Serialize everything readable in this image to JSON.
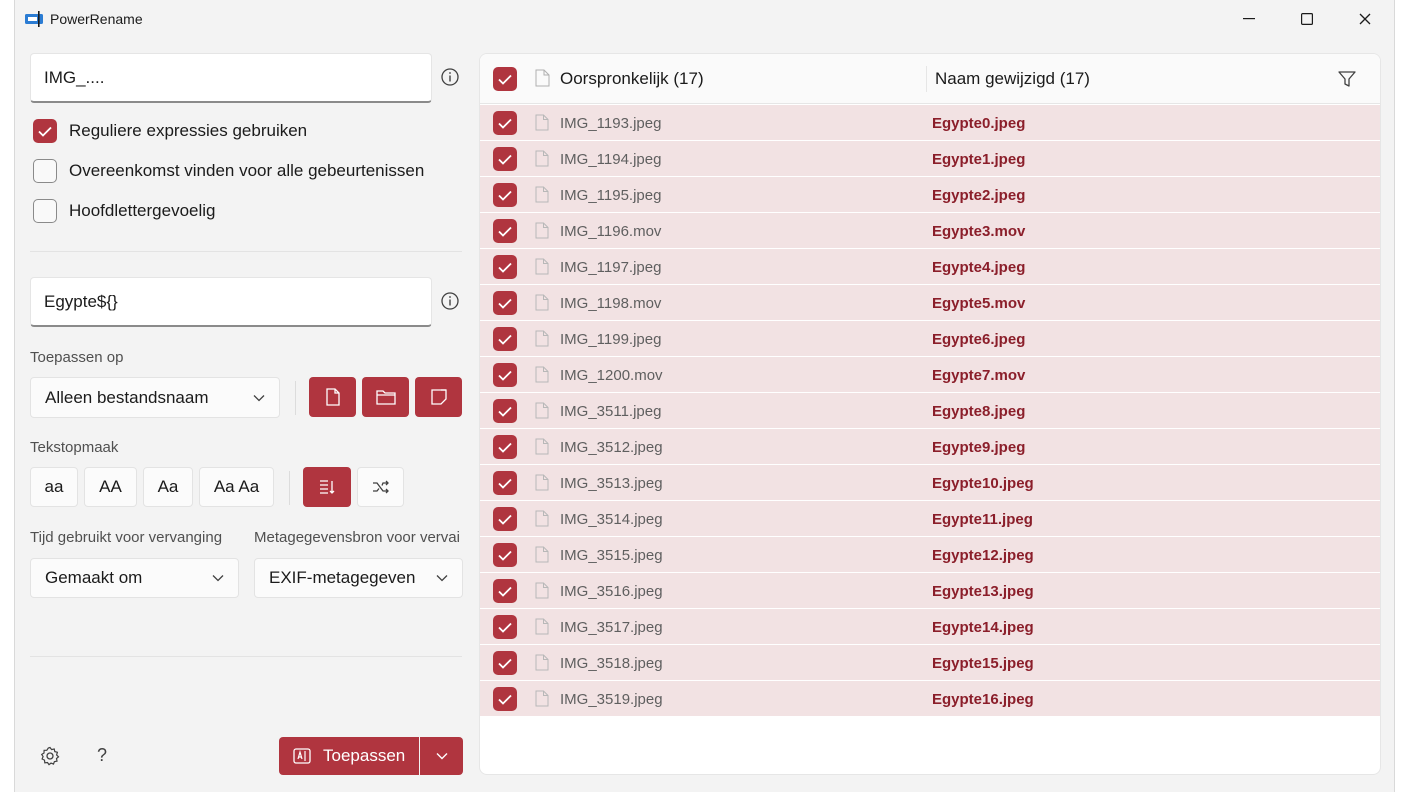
{
  "window": {
    "title": "PowerRename"
  },
  "search": {
    "value": "IMG_...."
  },
  "options": {
    "regex": {
      "label": "Reguliere expressies gebruiken",
      "checked": true
    },
    "match_all": {
      "label": "Overeenkomst vinden voor alle gebeurtenissen",
      "checked": false
    },
    "case_sensitive": {
      "label": "Hoofdlettergevoelig",
      "checked": false
    }
  },
  "replace": {
    "value": "Egypte${}"
  },
  "apply_to": {
    "label": "Toepassen op",
    "selected": "Alleen bestandsnaam"
  },
  "text_format": {
    "label": "Tekstopmaak",
    "buttons": [
      "aa",
      "AA",
      "Aa",
      "Aa Aa"
    ]
  },
  "time_used": {
    "label": "Tijd gebruikt voor vervanging",
    "selected": "Gemaakt om"
  },
  "metadata_source": {
    "label": "Metagegevensbron voor vervai",
    "selected": "EXIF-metagegeven"
  },
  "apply_button": {
    "label": "Toepassen"
  },
  "help": {
    "label": "?"
  },
  "list": {
    "original_header": "Oorspronkelijk (17)",
    "renamed_header": "Naam gewijzigd (17)",
    "rows": [
      {
        "original": "IMG_1193.jpeg",
        "renamed": "Egypte0.jpeg"
      },
      {
        "original": "IMG_1194.jpeg",
        "renamed": "Egypte1.jpeg"
      },
      {
        "original": "IMG_1195.jpeg",
        "renamed": "Egypte2.jpeg"
      },
      {
        "original": "IMG_1196.mov",
        "renamed": "Egypte3.mov"
      },
      {
        "original": "IMG_1197.jpeg",
        "renamed": "Egypte4.jpeg"
      },
      {
        "original": "IMG_1198.mov",
        "renamed": "Egypte5.mov"
      },
      {
        "original": "IMG_1199.jpeg",
        "renamed": "Egypte6.jpeg"
      },
      {
        "original": "IMG_1200.mov",
        "renamed": "Egypte7.mov"
      },
      {
        "original": "IMG_3511.jpeg",
        "renamed": "Egypte8.jpeg"
      },
      {
        "original": "IMG_3512.jpeg",
        "renamed": "Egypte9.jpeg"
      },
      {
        "original": "IMG_3513.jpeg",
        "renamed": "Egypte10.jpeg"
      },
      {
        "original": "IMG_3514.jpeg",
        "renamed": "Egypte11.jpeg"
      },
      {
        "original": "IMG_3515.jpeg",
        "renamed": "Egypte12.jpeg"
      },
      {
        "original": "IMG_3516.jpeg",
        "renamed": "Egypte13.jpeg"
      },
      {
        "original": "IMG_3517.jpeg",
        "renamed": "Egypte14.jpeg"
      },
      {
        "original": "IMG_3518.jpeg",
        "renamed": "Egypte15.jpeg"
      },
      {
        "original": "IMG_3519.jpeg",
        "renamed": "Egypte16.jpeg"
      }
    ]
  },
  "colors": {
    "accent": "#b0353f",
    "row_bg": "#f2e2e3",
    "renamed_text": "#8b1e2a"
  }
}
